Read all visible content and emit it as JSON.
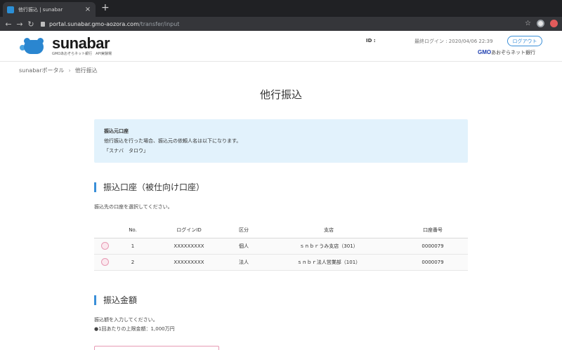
{
  "browser": {
    "tab_title": "他行振込 | sunabar",
    "url_host": "portal.sunabar.gmo-aozora.com",
    "url_path": "/transfer/input"
  },
  "header": {
    "logo_word": "sunabar",
    "logo_sub": "GMOあおぞらネット銀行　API実験場",
    "id_label": "ID :",
    "last_login": "最終ログイン : 2020/04/06 22:39",
    "logout_label": "ログアウト",
    "bank_gmo": "GMO",
    "bank_name": "あおぞらネット銀行"
  },
  "breadcrumb": {
    "home": "sunabarポータル",
    "separator": "›",
    "current": "他行振込"
  },
  "page_title": "他行振込",
  "info": {
    "title": "振込元口座",
    "text": "他行振込を行った場合、振込元の依頼人名は以下になります。",
    "name": "「スナバ　タロウ」"
  },
  "section_account": {
    "title": "振込口座（被仕向け口座）",
    "desc": "振込先の口座を選択してください。",
    "columns": [
      "No.",
      "ログインID",
      "区分",
      "支店",
      "口座番号"
    ],
    "rows": [
      {
        "no": "1",
        "login_id": "XXXXXXXXX",
        "type": "個人",
        "branch": "ｓｎｂｒうみ支店（301）",
        "account": "0000079"
      },
      {
        "no": "2",
        "login_id": "XXXXXXXXX",
        "type": "法人",
        "branch": "ｓｎｂｒ法人営業部（101）",
        "account": "0000079"
      }
    ]
  },
  "section_amount": {
    "title": "振込金額",
    "desc": "振込額を入力してください。",
    "limit": "●1回あたりの上限金額：1,000万円"
  },
  "colors": {
    "accent": "#3a8fd8",
    "info_bg": "#e2f2fc",
    "radio_bg": "#f9dde6"
  }
}
